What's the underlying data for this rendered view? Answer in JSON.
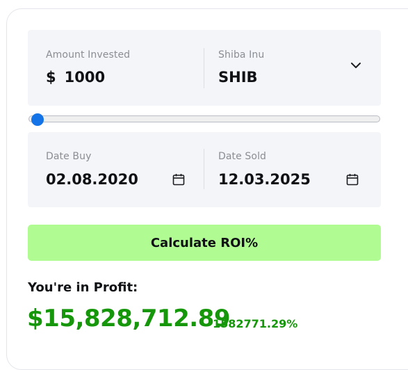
{
  "investment": {
    "amount_label": "Amount Invested",
    "currency_symbol": "$",
    "amount_value": "1000",
    "coin_name": "Shiba Inu",
    "coin_symbol": "SHIB"
  },
  "slider": {
    "level_fraction": 0.02
  },
  "dates": {
    "buy_label": "Date Buy",
    "buy_value": "02.08.2020",
    "sold_label": "Date Sold",
    "sold_value": "12.03.2025"
  },
  "action": {
    "calculate_label": "Calculate ROI%"
  },
  "result": {
    "heading": "You're in Profit:",
    "amount": "$15,828,712.89",
    "percent": "1582771.29%"
  },
  "icons": {
    "dropdown": "chevron-down-icon",
    "date_picker": "calendar-icon"
  },
  "colors": {
    "button_bg": "#b0fc92",
    "profit_green": "#16970b",
    "slider_thumb": "#1473e6",
    "panel_bg": "#f4f5f8"
  }
}
